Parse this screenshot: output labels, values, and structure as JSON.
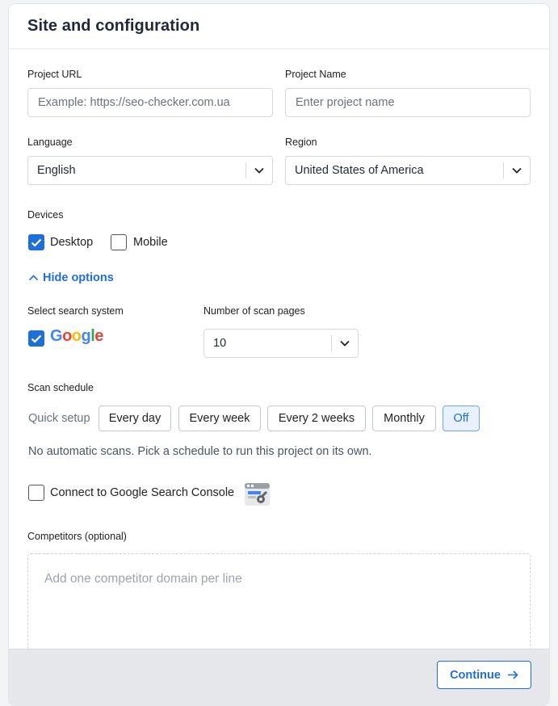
{
  "header": {
    "title": "Site and configuration"
  },
  "project_url": {
    "label": "Project URL",
    "value": "",
    "placeholder": "Example: https://seo-checker.com.ua"
  },
  "project_name": {
    "label": "Project Name",
    "value": "",
    "placeholder": "Enter project name"
  },
  "language": {
    "label": "Language",
    "selected": "English"
  },
  "region": {
    "label": "Region",
    "selected": "United States of America"
  },
  "devices": {
    "label": "Devices",
    "options": [
      {
        "label": "Desktop",
        "checked": true
      },
      {
        "label": "Mobile",
        "checked": false
      }
    ]
  },
  "options_toggle": {
    "label": "Hide options"
  },
  "search_system": {
    "label": "Select search system",
    "engine": "Google",
    "checked": true
  },
  "scan_pages": {
    "label": "Number of scan pages",
    "selected": "10"
  },
  "schedule": {
    "label": "Scan schedule",
    "quick_setup_label": "Quick setup",
    "options": [
      "Every day",
      "Every week",
      "Every 2 weeks",
      "Monthly",
      "Off"
    ],
    "selected": "Off",
    "hint": "No automatic scans. Pick a schedule to run this project on its own."
  },
  "gsc": {
    "label": "Connect to Google Search Console",
    "checked": false,
    "icon": "search-console-icon"
  },
  "competitors": {
    "label": "Competitors (optional)",
    "value": "",
    "placeholder": "Add one competitor domain per line"
  },
  "footer": {
    "continue_label": "Continue"
  },
  "colors": {
    "accent": "#1e6fd9",
    "footer_bg": "#e5e7eb"
  }
}
